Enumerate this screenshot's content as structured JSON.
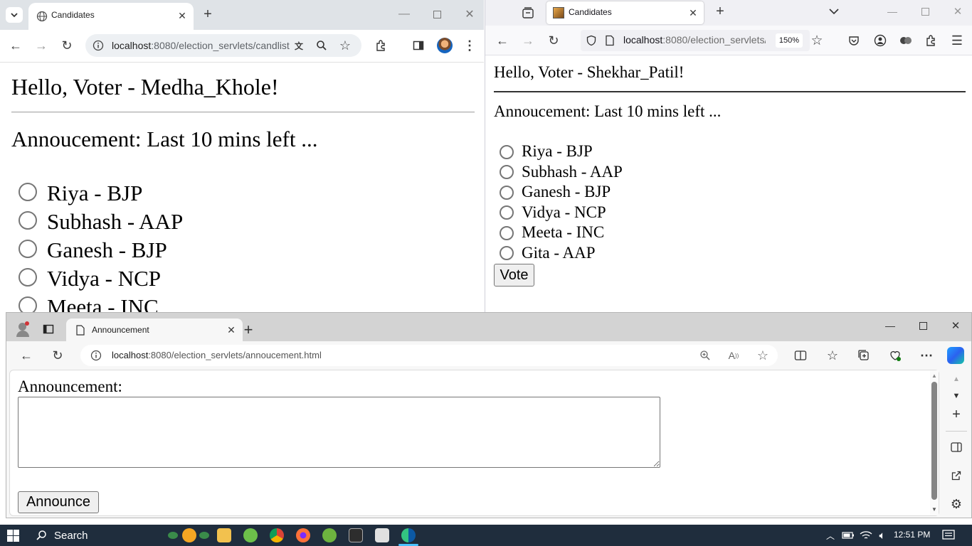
{
  "chrome": {
    "tab_title": "Candidates",
    "url_host": "localhost",
    "url_rest": ":8080/election_servlets/candlist",
    "greeting": "Hello, Voter - Medha_Khole!",
    "announcement": "Annoucement: Last 10 mins left ...",
    "candidates": [
      "Riya - BJP",
      "Subhash - AAP",
      "Ganesh - BJP",
      "Vidya - NCP",
      "Meeta - INC"
    ]
  },
  "firefox": {
    "tab_title": "Candidates",
    "url_host": "localhost",
    "url_rest": ":8080/election_servlets/",
    "zoom": "150%",
    "greeting": "Hello, Voter - Shekhar_Patil!",
    "announcement": "Annoucement: Last 10 mins left ...",
    "candidates": [
      "Riya - BJP",
      "Subhash - AAP",
      "Ganesh - BJP",
      "Vidya - NCP",
      "Meeta - INC",
      "Gita - AAP"
    ],
    "vote_button": "Vote"
  },
  "edge": {
    "tab_title": "Announcement",
    "url_host": "localhost",
    "url_rest": ":8080/election_servlets/annoucement.html",
    "label": "Announcement:",
    "textarea_value": "",
    "announce_button": "Announce"
  },
  "taskbar": {
    "search_label": "Search",
    "time": "12:51 PM"
  }
}
